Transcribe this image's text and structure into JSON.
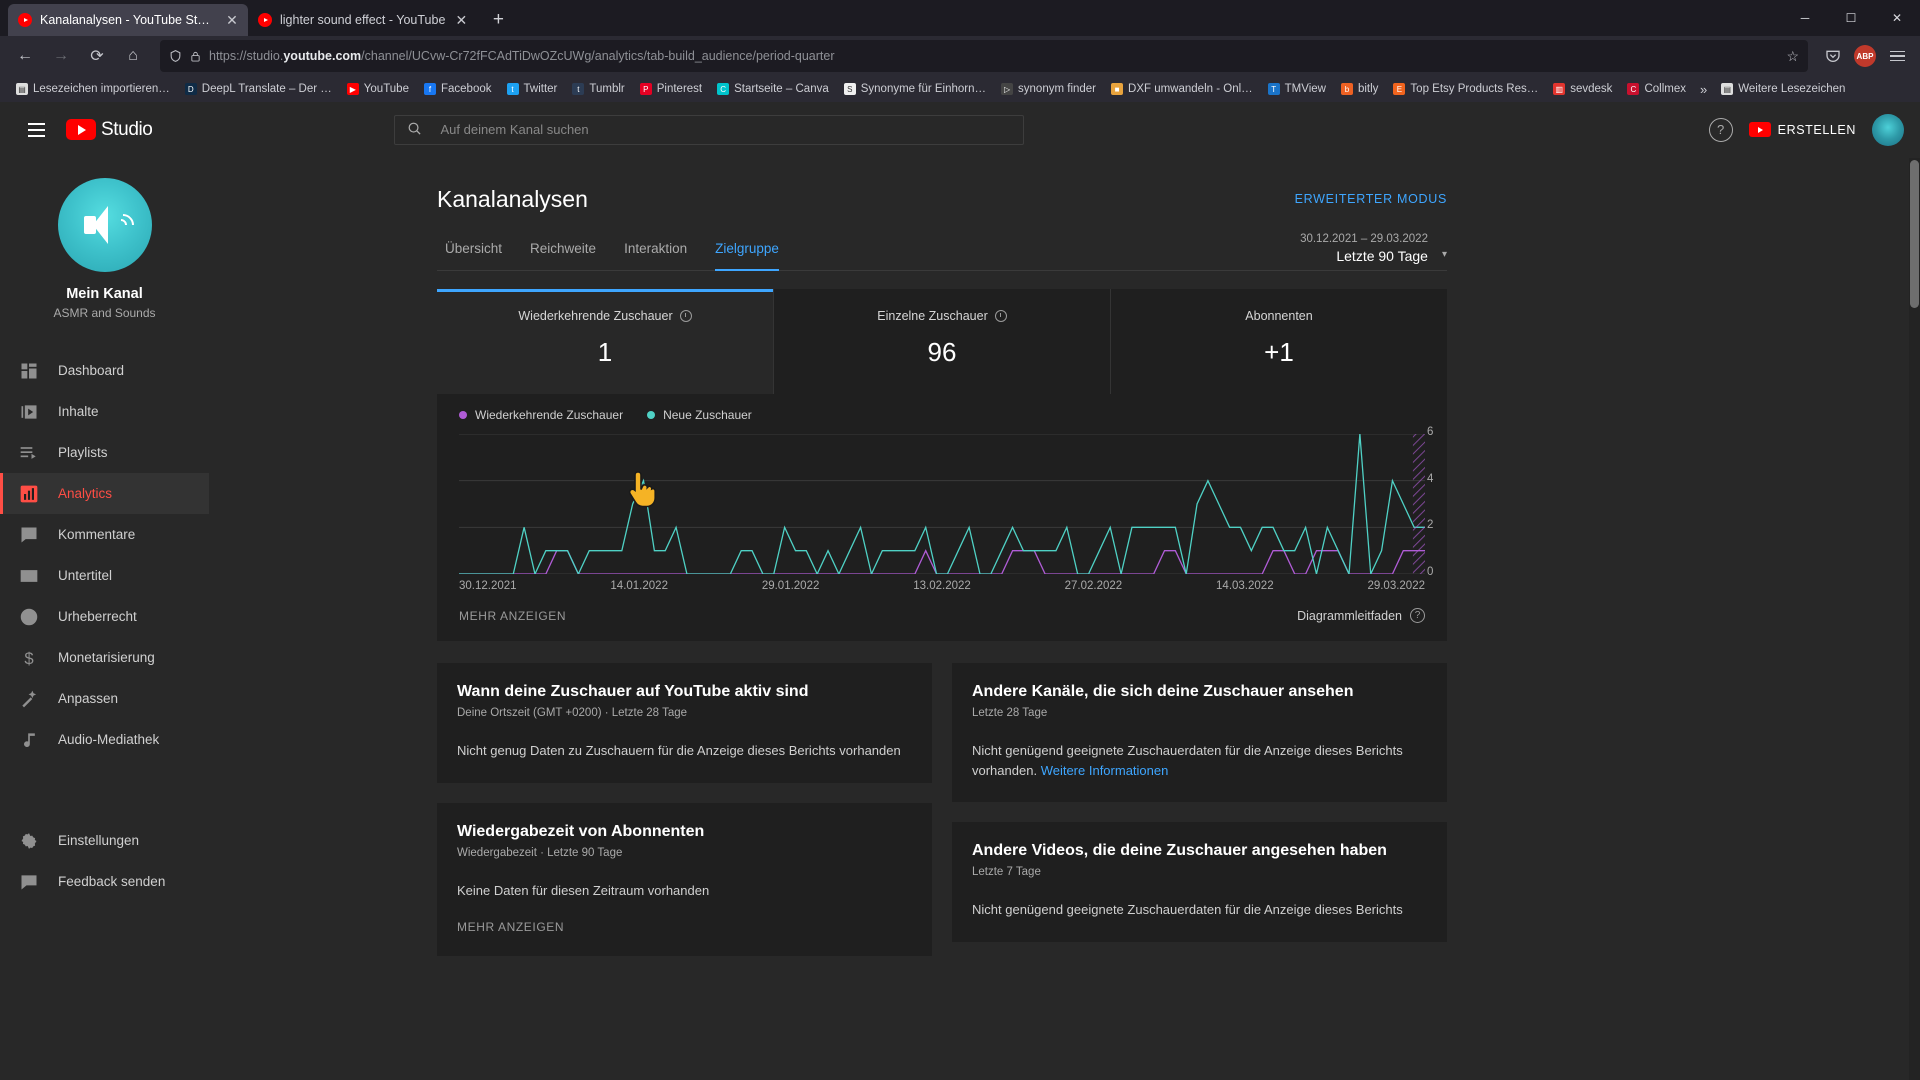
{
  "browser": {
    "tabs": [
      {
        "title": "Kanalanalysen - YouTube Studio",
        "active": true,
        "close": "✕"
      },
      {
        "title": "lighter sound effect - YouTube",
        "active": false,
        "close": "✕"
      }
    ],
    "new_tab_label": "+",
    "window_controls": {
      "minimize": "─",
      "maximize": "☐",
      "close": "✕"
    },
    "nav": {
      "back": "←",
      "forward": "→",
      "reload": "⟳",
      "home": "⌂"
    },
    "url": {
      "scheme": "https://studio.",
      "domain": "youtube.com",
      "path": "/channel/UCvw-Cr72fFCAdTiDwOZcUWg/analytics/tab-build_audience/period-quarter",
      "shield_icon": "shield-icon",
      "lock_icon": "lock-icon",
      "star_icon": "☆"
    },
    "toolbar_right": {
      "pocket": "pocket-icon",
      "adblock_badge": "ABP",
      "menu": "hamburger-icon"
    },
    "bookmarks": [
      {
        "label": "Lesezeichen importieren…",
        "color": "#dedede",
        "glyph": "▤"
      },
      {
        "label": "DeepL Translate – Der …",
        "color": "#0f2b46",
        "glyph": "D"
      },
      {
        "label": "YouTube",
        "color": "#ff0000",
        "glyph": "▶"
      },
      {
        "label": "Facebook",
        "color": "#1877f2",
        "glyph": "f"
      },
      {
        "label": "Twitter",
        "color": "#1da1f2",
        "glyph": "t"
      },
      {
        "label": "Tumblr",
        "color": "#2c3c54",
        "glyph": "t"
      },
      {
        "label": "Pinterest",
        "color": "#e60023",
        "glyph": "P"
      },
      {
        "label": "Startseite – Canva",
        "color": "#00c4cc",
        "glyph": "C"
      },
      {
        "label": "Synonyme für Einhorn…",
        "color": "#f0f0f0",
        "glyph": "S"
      },
      {
        "label": "synonym finder",
        "color": "#444444",
        "glyph": "▷"
      },
      {
        "label": "DXF umwandeln - Onl…",
        "color": "#e8a33d",
        "glyph": "■"
      },
      {
        "label": "TMView",
        "color": "#1a73c8",
        "glyph": "T"
      },
      {
        "label": "bitly",
        "color": "#ee6123",
        "glyph": "b"
      },
      {
        "label": "Top Etsy Products Res…",
        "color": "#f1641e",
        "glyph": "E"
      },
      {
        "label": "sevdesk",
        "color": "#e2342e",
        "glyph": "▥"
      },
      {
        "label": "Collmex",
        "color": "#c8102e",
        "glyph": "C"
      }
    ],
    "bookmarks_overflow": "»",
    "other_bookmarks": {
      "label": "Weitere Lesezeichen",
      "glyph": "▤",
      "color": "#dedede"
    }
  },
  "studio": {
    "header": {
      "menu_icon": "hamburger-icon",
      "logo_text": "Studio",
      "search_placeholder": "Auf deinem Kanal suchen",
      "search_value": "",
      "help_icon": "?",
      "create_label": "ERSTELLEN",
      "avatar": "account-avatar"
    },
    "sidebar": {
      "channel_name": "Mein Kanal",
      "channel_subtitle": "ASMR and Sounds",
      "items": [
        {
          "label": "Dashboard",
          "icon": "dashboard-icon",
          "active": false
        },
        {
          "label": "Inhalte",
          "icon": "content-video-icon",
          "active": false
        },
        {
          "label": "Playlists",
          "icon": "playlist-icon",
          "active": false
        },
        {
          "label": "Analytics",
          "icon": "analytics-bars-icon",
          "active": true
        },
        {
          "label": "Kommentare",
          "icon": "comment-icon",
          "active": false
        },
        {
          "label": "Untertitel",
          "icon": "subtitles-icon",
          "active": false
        },
        {
          "label": "Urheberrecht",
          "icon": "copyright-icon",
          "active": false
        },
        {
          "label": "Monetarisierung",
          "icon": "dollar-icon",
          "active": false
        },
        {
          "label": "Anpassen",
          "icon": "customize-wand-icon",
          "active": false
        },
        {
          "label": "Audio-Mediathek",
          "icon": "music-note-icon",
          "active": false
        }
      ],
      "bottom_items": [
        {
          "label": "Einstellungen",
          "icon": "gear-icon"
        },
        {
          "label": "Feedback senden",
          "icon": "feedback-icon"
        }
      ]
    },
    "page": {
      "title": "Kanalanalysen",
      "advanced_mode": "ERWEITERTER MODUS",
      "tabs": [
        {
          "label": "Übersicht",
          "active": false
        },
        {
          "label": "Reichweite",
          "active": false
        },
        {
          "label": "Interaktion",
          "active": false
        },
        {
          "label": "Zielgruppe",
          "active": true
        }
      ],
      "date_range": {
        "range": "30.12.2021 – 29.03.2022",
        "preset": "Letzte 90 Tage",
        "caret": "▾"
      }
    },
    "metrics": [
      {
        "label": "Wiederkehrende Zuschauer",
        "value": "1",
        "has_info": true,
        "selected": true
      },
      {
        "label": "Einzelne Zuschauer",
        "value": "96",
        "has_info": true,
        "selected": false
      },
      {
        "label": "Abonnenten",
        "value": "+1",
        "has_info": false,
        "selected": false
      }
    ],
    "chart_footer": {
      "show_more": "MEHR ANZEIGEN",
      "guide_label": "Diagrammleitfaden",
      "guide_help": "?"
    },
    "cards": {
      "left": [
        {
          "title": "Wann deine Zuschauer auf YouTube aktiv sind",
          "subtitle": "Deine Ortszeit (GMT +0200) · Letzte 28 Tage",
          "body": "Nicht genug Daten zu Zuschauern für die Anzeige dieses Berichts vorhanden",
          "link": "",
          "more": ""
        },
        {
          "title": "Wiedergabezeit von Abonnenten",
          "subtitle": "Wiedergabezeit · Letzte 90 Tage",
          "body": "Keine Daten für diesen Zeitraum vorhanden",
          "link": "",
          "more": "MEHR ANZEIGEN"
        }
      ],
      "right": [
        {
          "title": "Andere Kanäle, die sich deine Zuschauer ansehen",
          "subtitle": "Letzte 28 Tage",
          "body": "Nicht genügend geeignete Zuschauerdaten für die Anzeige dieses Berichts vorhanden.",
          "link": "Weitere Informationen",
          "more": ""
        },
        {
          "title": "Andere Videos, die deine Zuschauer angesehen haben",
          "subtitle": "Letzte 7 Tage",
          "body": "Nicht genügend geeignete Zuschauerdaten für die Anzeige dieses Berichts",
          "link": "",
          "more": ""
        }
      ]
    }
  },
  "chart_data": {
    "type": "line",
    "title": "",
    "xlabel": "",
    "ylabel": "",
    "ylim": [
      0,
      6
    ],
    "yticks": [
      0,
      2,
      4,
      6
    ],
    "grid": true,
    "legend_position": "top-left",
    "x_tick_labels": [
      "30.12.2021",
      "14.01.2022",
      "29.01.2022",
      "13.02.2022",
      "27.02.2022",
      "14.03.2022",
      "29.03.2022"
    ],
    "series": [
      {
        "name": "Wiederkehrende Zuschauer",
        "color": "#b05cd6",
        "values": [
          0,
          0,
          0,
          0,
          0,
          0,
          0,
          0,
          0,
          1,
          1,
          0,
          0,
          0,
          0,
          0,
          0,
          0,
          0,
          0,
          0,
          0,
          0,
          0,
          0,
          0,
          0,
          0,
          0,
          0,
          0,
          0,
          0,
          0,
          0,
          0,
          0,
          0,
          0,
          0,
          0,
          0,
          0,
          1,
          0,
          0,
          0,
          0,
          0,
          0,
          0,
          1,
          1,
          1,
          0,
          0,
          0,
          0,
          0,
          0,
          0,
          0,
          0,
          0,
          0,
          1,
          1,
          0,
          0,
          0,
          0,
          0,
          0,
          0,
          0,
          1,
          1,
          0,
          0,
          1,
          1,
          1,
          0,
          0,
          0,
          0,
          0,
          1,
          1,
          1
        ]
      },
      {
        "name": "Neue Zuschauer",
        "color": "#4fd1c5",
        "values": [
          0,
          0,
          0,
          0,
          0,
          0,
          2,
          0,
          1,
          1,
          1,
          0,
          1,
          1,
          1,
          1,
          3,
          4,
          1,
          1,
          2,
          0,
          0,
          0,
          0,
          0,
          1,
          1,
          0,
          0,
          2,
          1,
          1,
          0,
          1,
          0,
          1,
          2,
          0,
          1,
          1,
          1,
          1,
          2,
          0,
          0,
          1,
          2,
          0,
          0,
          1,
          2,
          1,
          1,
          1,
          1,
          2,
          0,
          0,
          1,
          2,
          0,
          2,
          2,
          2,
          2,
          2,
          0,
          3,
          4,
          3,
          2,
          2,
          1,
          2,
          2,
          1,
          1,
          2,
          0,
          2,
          1,
          0,
          6,
          0,
          1,
          4,
          3,
          2,
          2
        ]
      }
    ]
  }
}
